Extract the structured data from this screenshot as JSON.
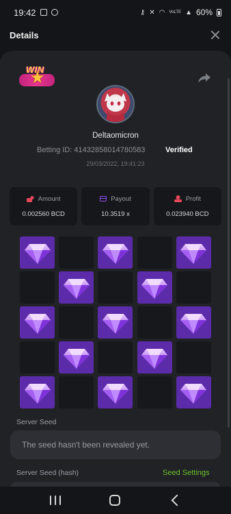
{
  "status_bar": {
    "time": "19:42",
    "battery_text": "60%",
    "network_label": "VoLTE"
  },
  "header": {
    "title": "Details"
  },
  "bet": {
    "username": "Deltaomicron",
    "betting_id_label": "Betting ID:",
    "betting_id": "41432858014780583",
    "verified_label": "Verified",
    "timestamp": "29/03/2022, 19:41:23",
    "badge_text": "WIN"
  },
  "stats": [
    {
      "label": "Amount",
      "value": "0.002560 BCD",
      "icon": "amount-icon",
      "color": "#e8475b"
    },
    {
      "label": "Payout",
      "value": "10.3519 x",
      "icon": "payout-icon",
      "color": "#8c4df0"
    },
    {
      "label": "Profit",
      "value": "0.023940 BCD",
      "icon": "profit-icon",
      "color": "#e8475b"
    }
  ],
  "grid": [
    [
      "gem",
      "empty",
      "gem",
      "empty",
      "gem"
    ],
    [
      "empty",
      "gem",
      "empty",
      "gem",
      "empty"
    ],
    [
      "gem",
      "empty",
      "gem",
      "empty",
      "gem"
    ],
    [
      "empty",
      "gem",
      "empty",
      "gem",
      "empty"
    ],
    [
      "gem",
      "empty",
      "gem",
      "empty",
      "gem"
    ]
  ],
  "server_seed": {
    "label": "Server Seed",
    "value": "The seed hasn't been revealed yet.",
    "hash_label": "Server Seed (hash)",
    "settings_label": "Seed Settings"
  },
  "colors": {
    "gem_tile": "#5c2ba9",
    "accent_green": "#6dc22b",
    "card_bg": "#202226"
  }
}
